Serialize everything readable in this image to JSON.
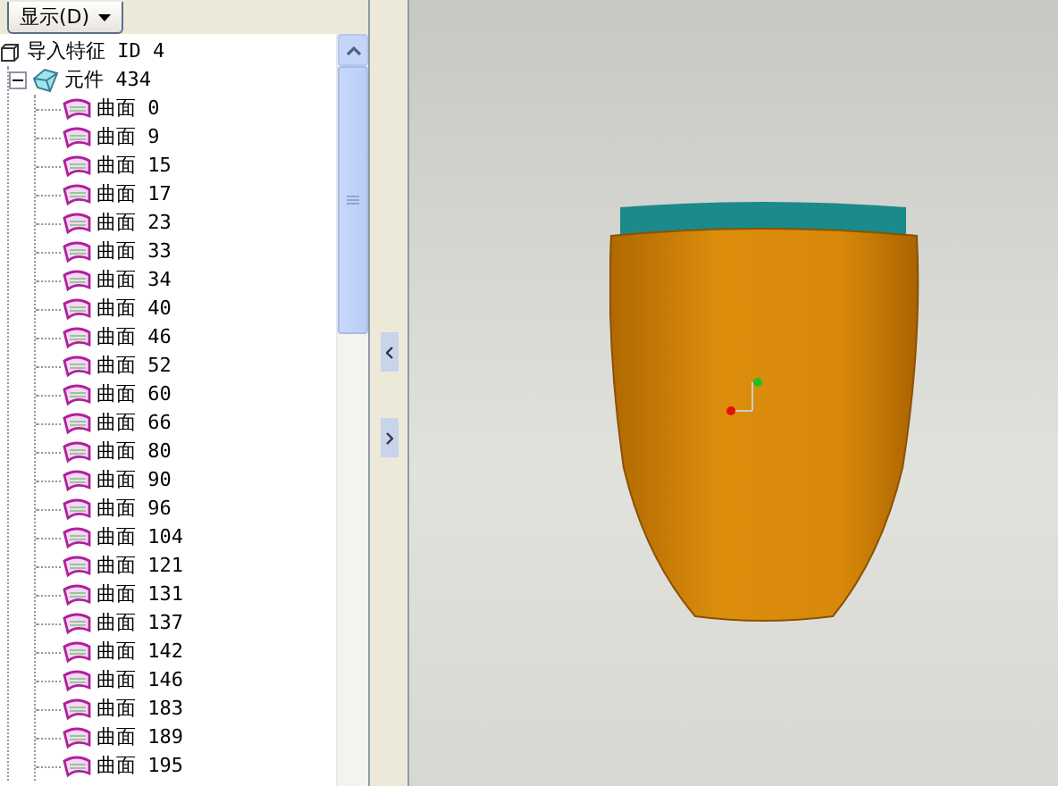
{
  "display_button": {
    "label": "显示(D)"
  },
  "tree": {
    "label": "导入特征 ID 4",
    "kind": "feature",
    "children": [
      {
        "label": "元件 434",
        "kind": "part",
        "expanded": true,
        "children": [
          {
            "label": "曲面 0",
            "kind": "surface"
          },
          {
            "label": "曲面 9",
            "kind": "surface"
          },
          {
            "label": "曲面 15",
            "kind": "surface"
          },
          {
            "label": "曲面 17",
            "kind": "surface"
          },
          {
            "label": "曲面 23",
            "kind": "surface"
          },
          {
            "label": "曲面 33",
            "kind": "surface"
          },
          {
            "label": "曲面 34",
            "kind": "surface"
          },
          {
            "label": "曲面 40",
            "kind": "surface"
          },
          {
            "label": "曲面 46",
            "kind": "surface"
          },
          {
            "label": "曲面 52",
            "kind": "surface"
          },
          {
            "label": "曲面 60",
            "kind": "surface"
          },
          {
            "label": "曲面 66",
            "kind": "surface"
          },
          {
            "label": "曲面 80",
            "kind": "surface"
          },
          {
            "label": "曲面 90",
            "kind": "surface"
          },
          {
            "label": "曲面 96",
            "kind": "surface"
          },
          {
            "label": "曲面 104",
            "kind": "surface"
          },
          {
            "label": "曲面 121",
            "kind": "surface"
          },
          {
            "label": "曲面 131",
            "kind": "surface"
          },
          {
            "label": "曲面 137",
            "kind": "surface"
          },
          {
            "label": "曲面 142",
            "kind": "surface"
          },
          {
            "label": "曲面 146",
            "kind": "surface"
          },
          {
            "label": "曲面 183",
            "kind": "surface"
          },
          {
            "label": "曲面 189",
            "kind": "surface"
          },
          {
            "label": "曲面 195",
            "kind": "surface"
          }
        ]
      }
    ]
  }
}
